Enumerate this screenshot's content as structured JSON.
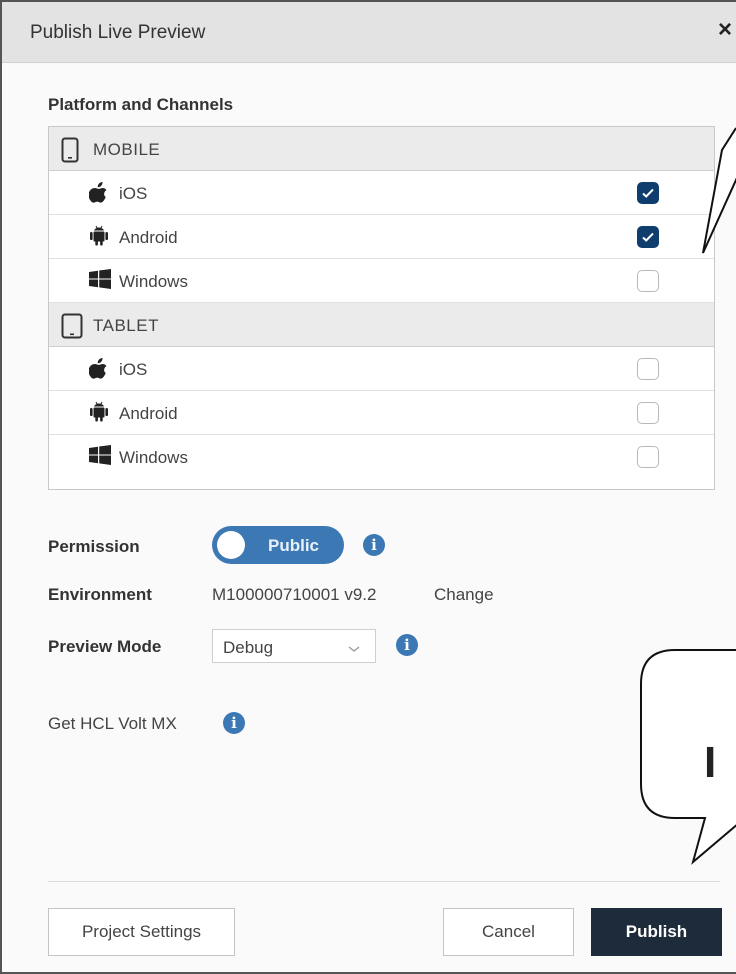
{
  "dialog": {
    "title": "Publish Live Preview",
    "close_label": "×"
  },
  "platform_section": {
    "label": "Platform and Channels",
    "groups": [
      {
        "name": "MOBILE",
        "icon": "mobile-phone-icon",
        "channels": [
          {
            "name": "iOS",
            "icon": "apple-icon",
            "checked": true
          },
          {
            "name": "Android",
            "icon": "android-icon",
            "checked": true
          },
          {
            "name": "Windows",
            "icon": "windows-icon",
            "checked": false
          }
        ]
      },
      {
        "name": "TABLET",
        "icon": "tablet-icon",
        "channels": [
          {
            "name": "iOS",
            "icon": "apple-icon",
            "checked": false
          },
          {
            "name": "Android",
            "icon": "android-icon",
            "checked": false
          },
          {
            "name": "Windows",
            "icon": "windows-icon",
            "checked": false
          }
        ]
      }
    ]
  },
  "permission": {
    "label": "Permission",
    "toggle_text": "Public"
  },
  "environment": {
    "label": "Environment",
    "value": "M100000710001 v9.2",
    "change_label": "Change"
  },
  "preview_mode": {
    "label": "Preview Mode",
    "selected": "Debug"
  },
  "get_hcl": {
    "label": "Get HCL Volt MX"
  },
  "footer": {
    "project_settings_label": "Project Settings",
    "cancel_label": "Cancel",
    "publish_label": "Publish"
  },
  "callout": {
    "text": "I"
  },
  "colors": {
    "accent": "#3c78b4",
    "checkbox_checked": "#0f3d6e",
    "primary_button": "#1e2b3a"
  }
}
